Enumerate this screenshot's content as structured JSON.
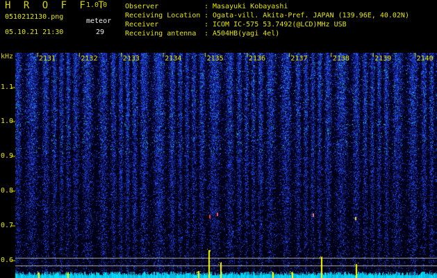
{
  "app": {
    "title": "H R O F F T",
    "version": "1.0.0"
  },
  "file": {
    "name": "0510212130.png",
    "datetime": "05.10.21 21:30"
  },
  "meteor": {
    "label": "meteor",
    "count": "29"
  },
  "info": [
    {
      "label": "Observer",
      "sep": ":",
      "value": "Masayuki Kobayashi"
    },
    {
      "label": "Receiving Location",
      "sep": ":",
      "value": "Ogata-vill. Akita-Pref. JAPAN (139.96E, 40.02N)"
    },
    {
      "label": "Receiver",
      "sep": ":",
      "value": "ICOM IC-575 53.7492(@LCD)MHz USB"
    },
    {
      "label": "Receiving antenna",
      "sep": ":",
      "value": "A504HB(yagi 4el)"
    }
  ],
  "axis": {
    "unit": "kHz",
    "time_ticks": [
      "2131",
      "2132",
      "2133",
      "2134",
      "2135",
      "2136",
      "2137",
      "2138",
      "2139",
      "2140"
    ],
    "freq_ticks": [
      "1.1",
      "1.0",
      "0.9",
      "0.8",
      "0.7",
      "0.6"
    ]
  },
  "colors": {
    "background": "#000000",
    "header_text": "#e6e600",
    "spectrum_noise": "#1e3cb4",
    "baseline": "#00e0ff",
    "meteor_echo": "#ffff00"
  }
}
